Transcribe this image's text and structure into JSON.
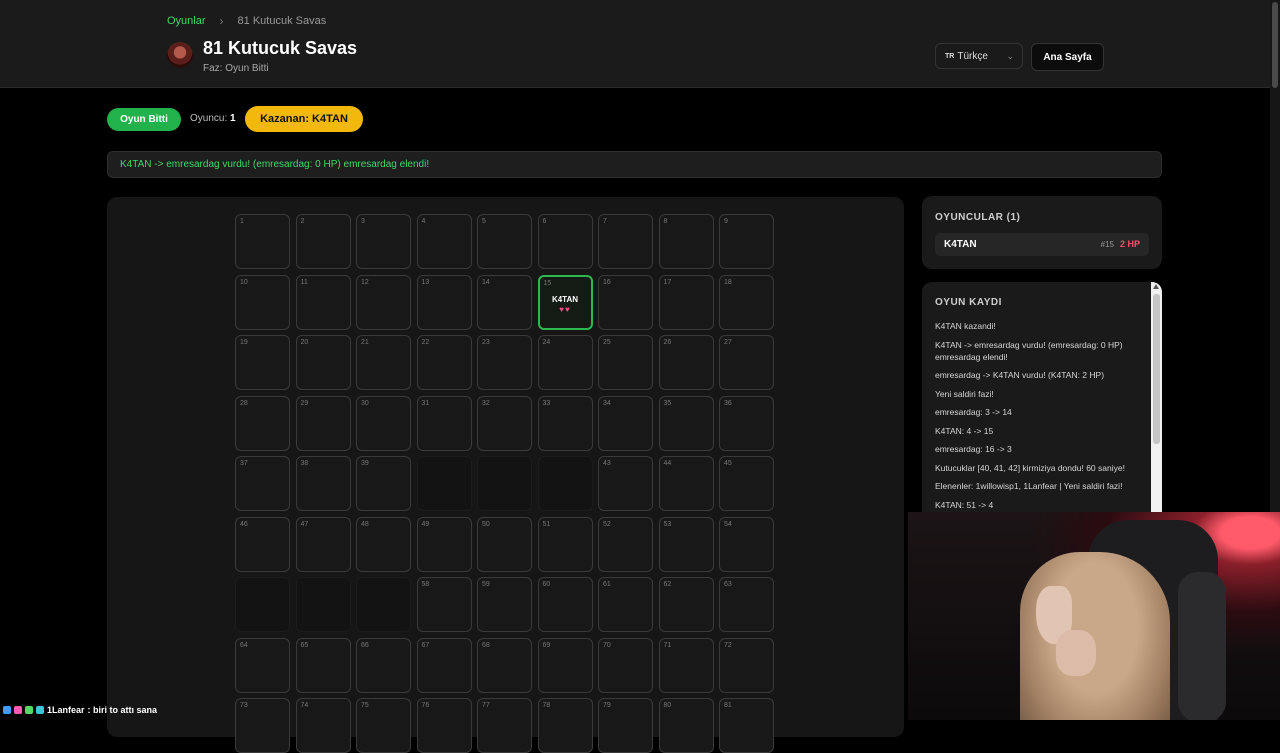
{
  "breadcrumb": {
    "root": "Oyunlar",
    "separator": "›",
    "current": "81 Kutucuk Savas"
  },
  "header": {
    "title": "81 Kutucuk Savas",
    "phase": "Faz: Oyun Bitti",
    "language": {
      "flag": "TR",
      "label": "Türkçe"
    },
    "home_button": "Ana Sayfa"
  },
  "status": {
    "state_badge": "Oyun Bitti",
    "players_label": "Oyuncu:",
    "players_count": "1",
    "winner_badge": "Kazanan: K4TAN"
  },
  "banner": "K4TAN -> emresardag vurdu! (emresardag: 0 HP) emresardag elendi!",
  "board": {
    "columns": 9,
    "rows": 9,
    "eliminated_cells": [
      40,
      41,
      42,
      55,
      56,
      57
    ],
    "occupied": [
      {
        "cell": 15,
        "player": "K4TAN",
        "hearts": "♥♥"
      }
    ]
  },
  "players_panel": {
    "title": "OYUNCULAR (1)",
    "players": [
      {
        "name": "K4TAN",
        "cell": "#15",
        "hp": "2 HP"
      }
    ]
  },
  "log_panel": {
    "title": "OYUN KAYDI",
    "items": [
      "K4TAN kazandi!",
      "K4TAN -> emresardag vurdu! (emresardag: 0 HP) emresardag elendi!",
      "emresardag -> K4TAN vurdu! (K4TAN: 2 HP)",
      "Yeni saldiri fazi!",
      "emresardag: 3 -> 14",
      "K4TAN: 4 -> 15",
      "emresardag: 16 -> 3",
      "Kutucuklar [40, 41, 42] kirmiziya dondu! 60 saniye!",
      "Elenenler: 1willowisp1, 1Lanfear | Yeni saldiri fazi!",
      "K4TAN: 51 -> 4"
    ]
  },
  "chat": {
    "user": "1Lanfear",
    "message": ": biri to attı sana"
  },
  "colors": {
    "accent_green": "#22b24c",
    "winner_yellow": "#f2b90c",
    "hp_red": "#ff4f6a",
    "background": "#000000"
  }
}
